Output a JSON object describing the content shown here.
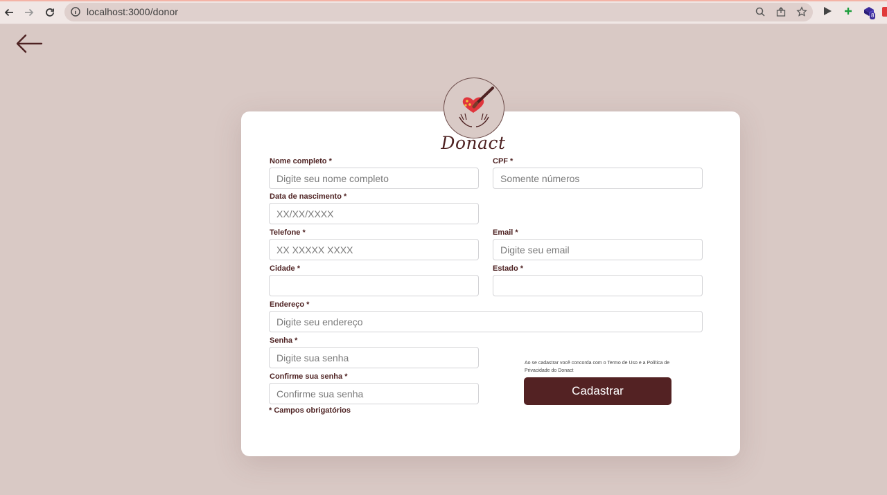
{
  "browser": {
    "url": "localhost:3000/donor",
    "extension_badge": "8"
  },
  "brand": {
    "name": "Donact"
  },
  "form": {
    "nome": {
      "label": "Nome completo *",
      "placeholder": "Digite seu nome completo",
      "value": ""
    },
    "cpf": {
      "label": "CPF *",
      "placeholder": "Somente números",
      "value": ""
    },
    "nascimento": {
      "label": "Data de nascimento *",
      "placeholder": "XX/XX/XXXX",
      "value": ""
    },
    "telefone": {
      "label": "Telefone *",
      "placeholder": "XX XXXXX XXXX",
      "value": ""
    },
    "email": {
      "label": "Email *",
      "placeholder": "Digite seu email",
      "value": ""
    },
    "cidade": {
      "label": "Cidade *",
      "placeholder": "",
      "value": ""
    },
    "estado": {
      "label": "Estado *",
      "placeholder": "",
      "value": ""
    },
    "endereco": {
      "label": "Endereço *",
      "placeholder": "Digite seu endereço",
      "value": ""
    },
    "senha": {
      "label": "Senha *",
      "placeholder": "Digite sua senha",
      "value": ""
    },
    "confirmar": {
      "label": "Confirme sua senha *",
      "placeholder": "Confirme sua senha",
      "value": ""
    },
    "terms": "Ao se cadastrar você concorda com o Termo de Uso e a Política de Privacidade do Donact",
    "submit_label": "Cadastrar",
    "required_note": "* Campos obrigatórios"
  },
  "colors": {
    "background": "#d9c9c5",
    "accent": "#532223",
    "label": "#4e2222"
  },
  "icons": [
    "back-icon",
    "forward-icon",
    "reload-icon",
    "info-icon",
    "zoom-icon",
    "share-icon",
    "star-icon",
    "play-icon",
    "plus-icon",
    "extension-icon",
    "back-arrow-icon",
    "logo-heart-icon"
  ]
}
